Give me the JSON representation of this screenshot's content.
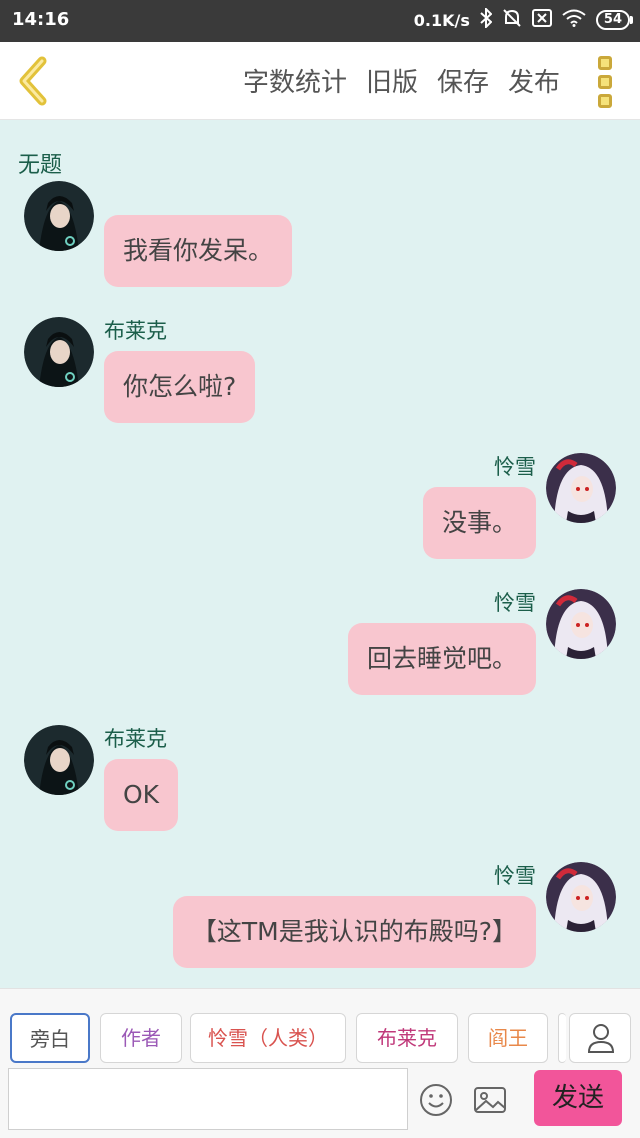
{
  "status_bar": {
    "time": "14:16",
    "net_speed": "0.1K/s",
    "battery": "54",
    "icons": [
      "bluetooth-icon",
      "mute-icon",
      "sim-off-icon",
      "wifi-icon",
      "battery-icon"
    ]
  },
  "header": {
    "actions": [
      "字数统计",
      "旧版",
      "保存",
      "发布"
    ],
    "icons": [
      "back-arrow-icon",
      "more-menu-icon"
    ]
  },
  "chat": {
    "title": "无题",
    "partial_top": {
      "bubble": "我看你发呆。"
    },
    "messages": [
      {
        "side": "left",
        "avatar": "dark-hair-avatar",
        "name": "布莱克",
        "text": "你怎么啦?"
      },
      {
        "side": "right",
        "avatar": "white-hair-avatar",
        "name": "怜雪",
        "text": "没事。"
      },
      {
        "side": "right",
        "avatar": "white-hair-avatar",
        "name": "怜雪",
        "text": "回去睡觉吧。"
      },
      {
        "side": "left",
        "avatar": "dark-hair-avatar",
        "name": "布莱克",
        "text": "OK"
      },
      {
        "side": "right",
        "avatar": "white-hair-avatar",
        "name": "怜雪",
        "text": "【这TM是我认识的布殿吗?】"
      }
    ]
  },
  "roles": [
    {
      "label": "旁白",
      "color": "#555555",
      "active": true
    },
    {
      "label": "作者",
      "color": "#9b59b6"
    },
    {
      "label": "怜雪（人类）",
      "color": "#d9534f"
    },
    {
      "label": "布莱克",
      "color": "#c0397a"
    },
    {
      "label": "阎王",
      "color": "#e8884a"
    }
  ],
  "input": {
    "value": "",
    "placeholder": "",
    "send_label": "发送",
    "icons": [
      "emoji-icon",
      "image-icon",
      "user-icon"
    ]
  },
  "colors": {
    "chat_bg": "#e0f2f1",
    "bubble": "#f8c6cf",
    "name_text": "#1b5e4a",
    "send_button": "#f2559a"
  }
}
